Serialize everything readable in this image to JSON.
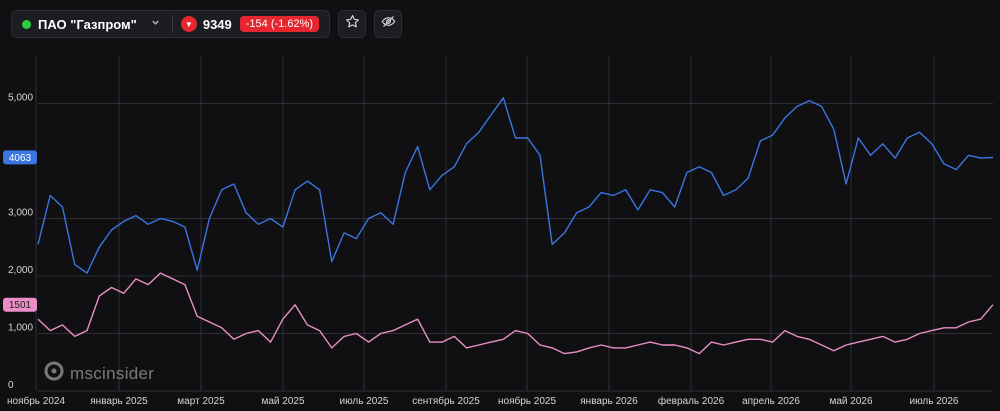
{
  "header": {
    "ticker_name": "ПАО \"Газпром\"",
    "price": "9349",
    "change": "-154 (-1.62%)",
    "colors": {
      "status_dot": "#2ecc40",
      "negative": "#e5262e"
    },
    "icons": [
      "chevron-down-icon",
      "star-icon",
      "eye-off-icon"
    ]
  },
  "watermark": {
    "text": "mscinsider"
  },
  "chart_data": {
    "type": "line",
    "x": [
      "ноябрь 2024",
      "январь 2025",
      "март 2025",
      "май 2025",
      "июль 2025",
      "сентябрь 2025",
      "ноябрь 2025",
      "январь 2026",
      "февраль 2026",
      "апрель 2026",
      "май 2026",
      "июль 2026"
    ],
    "yticks": [
      "0",
      "1,000",
      "2,000",
      "3,000",
      "5,000"
    ],
    "ylim": [
      0,
      5500
    ],
    "grid": true,
    "series": [
      {
        "color": "#3a75e0",
        "last_label": "4063",
        "values": [
          2550,
          3400,
          3200,
          2200,
          2050,
          2500,
          2800,
          2950,
          3050,
          2900,
          3000,
          2950,
          2850,
          2100,
          3000,
          3500,
          3600,
          3100,
          2900,
          3000,
          2850,
          3500,
          3650,
          3500,
          2250,
          2750,
          2650,
          3000,
          3100,
          2900,
          3800,
          4250,
          3500,
          3750,
          3900,
          4300,
          4500,
          4800,
          5100,
          4400,
          4400,
          4100,
          2550,
          2750,
          3100,
          3200,
          3450,
          3400,
          3500,
          3150,
          3500,
          3450,
          3200,
          3800,
          3900,
          3800,
          3400,
          3500,
          3700,
          4350,
          4450,
          4750,
          4950,
          5050,
          4950,
          4550,
          3600,
          4400,
          4100,
          4300,
          4050,
          4400,
          4500,
          4300,
          3950,
          3850,
          4100,
          4050,
          4063
        ]
      },
      {
        "color": "#e98fc6",
        "last_label": "1501",
        "values": [
          1250,
          1050,
          1150,
          950,
          1050,
          1650,
          1800,
          1700,
          1950,
          1850,
          2050,
          1950,
          1850,
          1300,
          1200,
          1100,
          900,
          1000,
          1050,
          850,
          1250,
          1500,
          1150,
          1050,
          750,
          950,
          1000,
          850,
          1000,
          1050,
          1150,
          1250,
          850,
          850,
          950,
          750,
          800,
          850,
          900,
          1050,
          1000,
          800,
          750,
          650,
          680,
          750,
          800,
          750,
          750,
          800,
          850,
          800,
          800,
          750,
          650,
          850,
          800,
          850,
          900,
          900,
          850,
          1050,
          950,
          900,
          800,
          700,
          800,
          850,
          900,
          950,
          850,
          900,
          1000,
          1050,
          1100,
          1100,
          1200,
          1250,
          1501
        ]
      }
    ]
  }
}
